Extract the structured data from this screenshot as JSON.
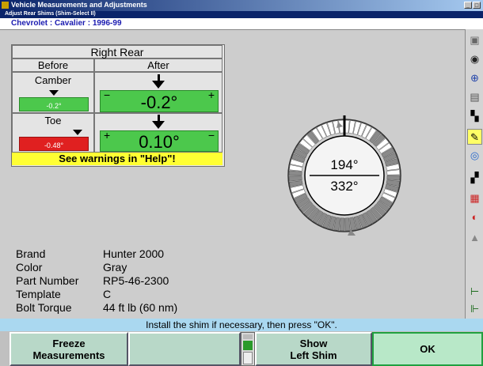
{
  "window": {
    "title": "Vehicle Measurements and Adjustments"
  },
  "screen": {
    "subtitle": "Adjust Rear Shims (Shim-Select II)"
  },
  "vehicle": {
    "name": "Chevrolet : Cavalier : 1996-99"
  },
  "panel": {
    "header": "Right Rear",
    "before_label": "Before",
    "after_label": "After",
    "camber": {
      "label": "Camber",
      "before": "-0.2°",
      "after": "-0.2°"
    },
    "toe": {
      "label": "Toe",
      "before": "-0.48°",
      "after": "0.10°"
    },
    "warning": "See warnings in \"Help\"!"
  },
  "dial": {
    "top_value": "194°",
    "bottom_value": "332°"
  },
  "shim_info": [
    {
      "label": "Brand",
      "value": "Hunter 2000"
    },
    {
      "label": "Color",
      "value": "Gray"
    },
    {
      "label": "Part Number",
      "value": "RP5-46-2300"
    },
    {
      "label": "Template",
      "value": "C"
    },
    {
      "label": "Bolt Torque",
      "value": "44 ft lb (60 nm)"
    }
  ],
  "status": "Install the shim if necessary, then press \"OK\".",
  "buttons": {
    "f1_line1": "Freeze",
    "f1_line2": "Measurements",
    "f2": "",
    "f3_line1": "Show",
    "f3_line2": "Left Shim",
    "f4": "OK"
  },
  "toolbar_icons": [
    "vehicle-icon",
    "tire-icon",
    "adjust-icon",
    "checkered-flag-icon",
    "highlight-icon",
    "spec-icon",
    "rim-icon",
    "car-icon"
  ],
  "colors": {
    "gauge_green": "#4cc84c",
    "gauge_red": "#e02020",
    "warning_yellow": "#ffff33",
    "status_blue": "#aad8f0"
  }
}
